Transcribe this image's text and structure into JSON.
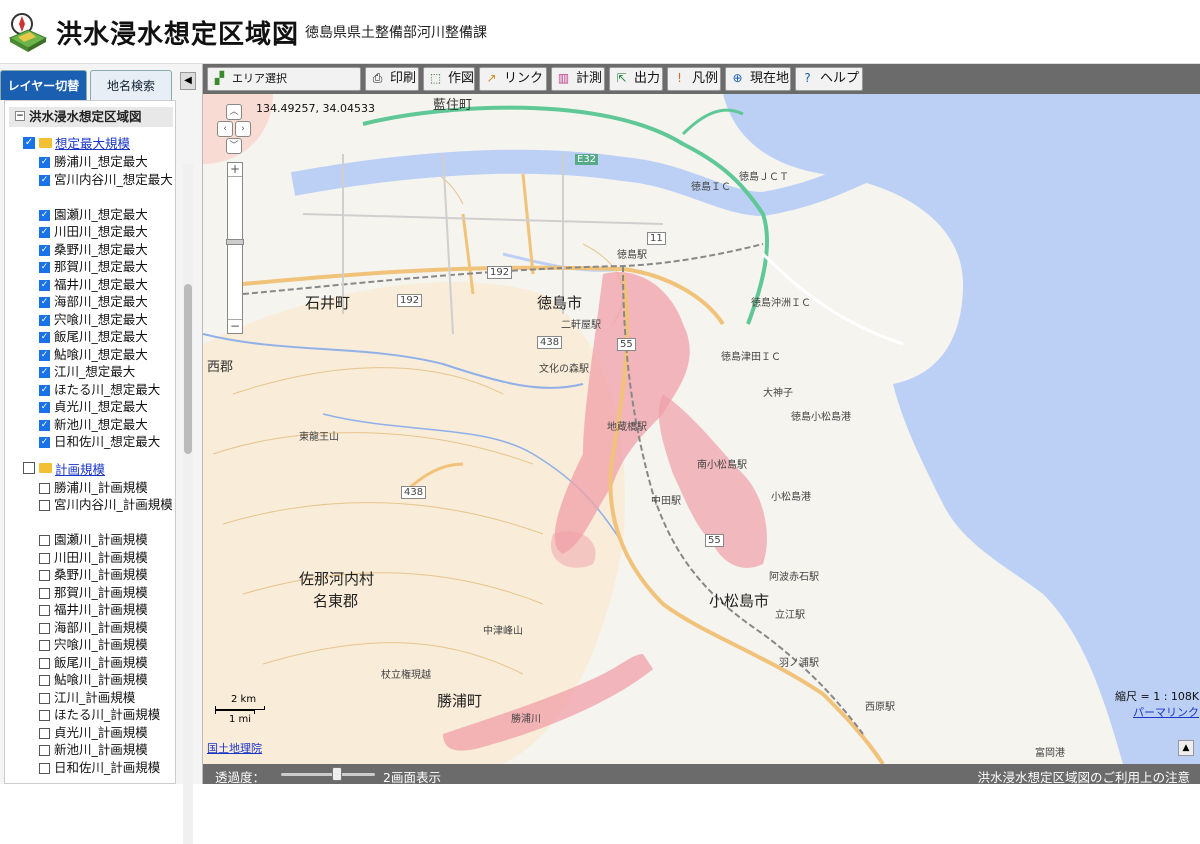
{
  "header": {
    "title": "洪水浸水想定区域図",
    "department": "徳島県県土整備部河川整備課"
  },
  "sidebar": {
    "tabs": [
      "レイヤー切替",
      "地名検索"
    ],
    "collapse_glyph": "◀",
    "root_label": "洪水浸水想定区域図",
    "groups": [
      {
        "label": "想定最大規模",
        "checked": true,
        "items": [
          "勝浦川_想定最大",
          "宮川内谷川_想定最大",
          "園瀬川_想定最大",
          "川田川_想定最大",
          "桑野川_想定最大",
          "那賀川_想定最大",
          "福井川_想定最大",
          "海部川_想定最大",
          "宍喰川_想定最大",
          "飯尾川_想定最大",
          "鮎喰川_想定最大",
          "江川_想定最大",
          "ほたる川_想定最大",
          "貞光川_想定最大",
          "新池川_想定最大",
          "日和佐川_想定最大"
        ]
      },
      {
        "label": "計画規模",
        "checked": false,
        "items": [
          "勝浦川_計画規模",
          "宮川内谷川_計画規模",
          "園瀬川_計画規模",
          "川田川_計画規模",
          "桑野川_計画規模",
          "那賀川_計画規模",
          "福井川_計画規模",
          "海部川_計画規模",
          "宍喰川_計画規模",
          "飯尾川_計画規模",
          "鮎喰川_計画規模",
          "江川_計画規模",
          "ほたる川_計画規模",
          "貞光川_計画規模",
          "新池川_計画規模",
          "日和佐川_計画規模"
        ]
      }
    ]
  },
  "toolbar": {
    "area_select": "エリア選択",
    "print": "印刷",
    "draw": "作図",
    "link": "リンク",
    "measure": "計測",
    "output": "出力",
    "legend": "凡例",
    "current_location": "現在地",
    "help": "ヘルプ"
  },
  "map": {
    "coordinates": "134.49257, 34.04533",
    "scale_km": "2 km",
    "scale_mi": "1 mi",
    "attribution": "国土地理院",
    "scale_ratio": "縮尺 = 1 : 108K",
    "permalink": "パーマリンク",
    "places": {
      "aizumi": "藍住町",
      "ishii": "石井町",
      "tokushima": "徳島市",
      "nishi": "西郡",
      "sanagochi": "佐那河内村",
      "myozai": "名東郡",
      "komatsushima": "小松島市",
      "katsuura": "勝浦町",
      "tokushima_ic": "徳島ＩＣ",
      "tokushima_jct": "徳島ＪＣＴ",
      "okinosu_ic": "徳島沖洲ＩＣ",
      "tsuda_ic": "徳島津田ＩＣ",
      "komatsushima_port": "徳島小松島港",
      "tokushima_sta": "徳島駅",
      "nikenya_sta": "二軒屋駅",
      "bunka_mori": "文化の森駅",
      "jizo_sta": "地蔵橋駅",
      "nakata_sta": "中田駅",
      "minami_komatsushima": "南小松島駅",
      "awa_tomioka": "阿波赤石駅",
      "tatsue_sta": "立江駅",
      "hanoura_sta": "羽ノ浦駅",
      "nishihara": "西原駅",
      "komatsushima_bay": "小松島港",
      "tomioka_port": "富岡港",
      "higashi_ryuo": "東龍王山",
      "nakatsu_mine": "中津峰山",
      "suga": "杖立権現越",
      "oogami": "大神子",
      "katsuura_river": "勝浦川",
      "e32": "E32",
      "r192": "192",
      "r438": "438",
      "r55": "55",
      "r11": "11"
    }
  },
  "bottom": {
    "opacity_label": "透過度：",
    "opacity_value": 0.6,
    "dual_screen": "2画面表示",
    "notice": "洪水浸水想定区域図のご利用上の注意"
  },
  "colors": {
    "tab_active": "#1a5fb0",
    "toolbar_bg": "#6b6b6b",
    "link": "#1a35c8",
    "flood_area": "#f0a0aa",
    "sea": "#bcd0f5",
    "expressway": "#5fc896"
  }
}
